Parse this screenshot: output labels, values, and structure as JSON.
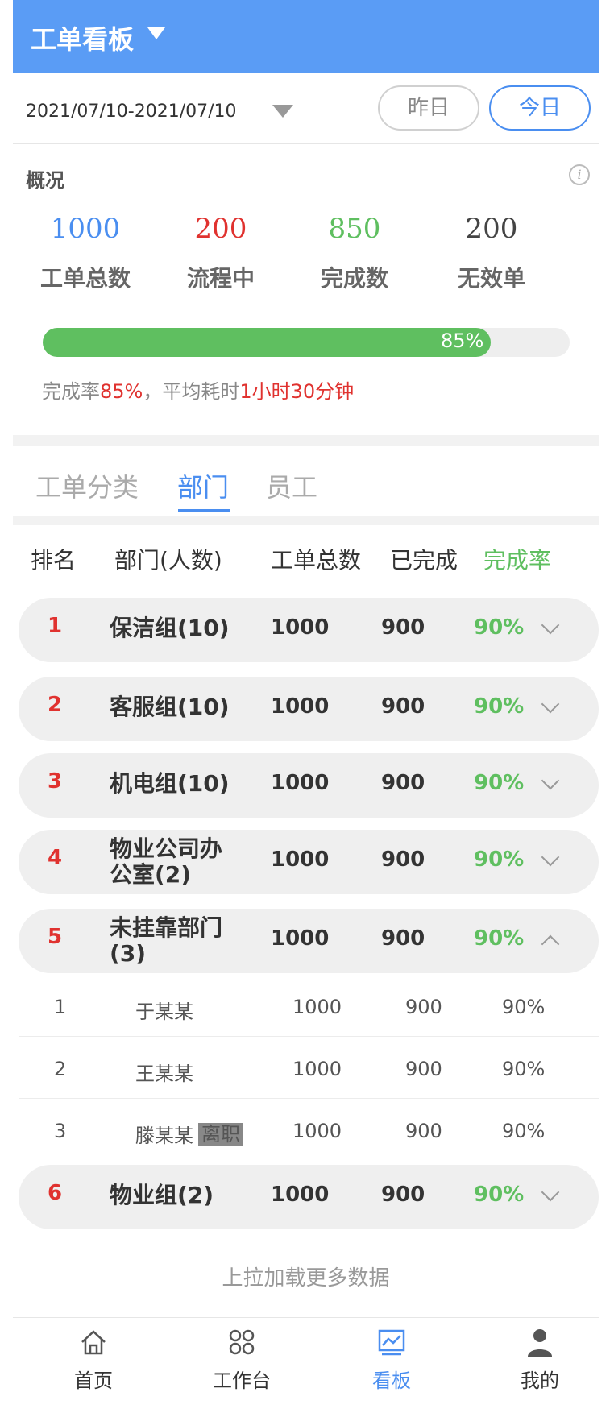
{
  "header": {
    "title": "工单看板"
  },
  "date_filter": {
    "range": "2021/07/10-2021/07/10",
    "yesterday": "昨日",
    "today": "今日"
  },
  "overview": {
    "title": "概况",
    "stats": [
      {
        "value": "1000",
        "label": "工单总数",
        "color": "#4a8ef0"
      },
      {
        "value": "200",
        "label": "流程中",
        "color": "#e0322f"
      },
      {
        "value": "850",
        "label": "完成数",
        "color": "#5fbf60"
      },
      {
        "value": "200",
        "label": "无效单",
        "color": "#444444"
      }
    ],
    "progress_percent": 85,
    "progress_text": "85%",
    "summary": {
      "prefix": "完成率",
      "rate": "85%",
      "mid": "，平均耗时",
      "duration": "1小时30分钟"
    }
  },
  "tabs": [
    "工单分类",
    "部门",
    "员工"
  ],
  "active_tab": "部门",
  "table": {
    "headers": [
      "排名",
      "部门(人数)",
      "工单总数",
      "已完成",
      "完成率"
    ],
    "rows": [
      {
        "rank": "1",
        "dept": "保洁组(10)",
        "total": "1000",
        "done": "900",
        "rate": "90%"
      },
      {
        "rank": "2",
        "dept": "客服组(10)",
        "total": "1000",
        "done": "900",
        "rate": "90%"
      },
      {
        "rank": "3",
        "dept": "机电组(10)",
        "total": "1000",
        "done": "900",
        "rate": "90%"
      },
      {
        "rank": "4",
        "dept": "物业公司办公室(2)",
        "total": "1000",
        "done": "900",
        "rate": "90%"
      },
      {
        "rank": "5",
        "dept": "未挂靠部门(3)",
        "total": "1000",
        "done": "900",
        "rate": "90%",
        "members": [
          {
            "rank": "1",
            "name": "于某某",
            "total": "1000",
            "done": "900",
            "rate": "90%"
          },
          {
            "rank": "2",
            "name": "王某某",
            "total": "1000",
            "done": "900",
            "rate": "90%"
          },
          {
            "rank": "3",
            "name": "滕某某",
            "badge": "离职",
            "total": "1000",
            "done": "900",
            "rate": "90%"
          }
        ]
      },
      {
        "rank": "6",
        "dept": "物业组(2)",
        "total": "1000",
        "done": "900",
        "rate": "90%"
      }
    ]
  },
  "load_more": "上拉加载更多数据",
  "bottom_nav": [
    {
      "label": "首页",
      "icon": "home-icon"
    },
    {
      "label": "工作台",
      "icon": "grid-icon"
    },
    {
      "label": "看板",
      "icon": "chart-icon"
    },
    {
      "label": "我的",
      "icon": "user-icon"
    }
  ],
  "bottom_nav_active": "看板",
  "colors": {
    "primary": "#5a9cf5",
    "accent_blue": "#4a8ef0",
    "red": "#e0322f",
    "green": "#5fbf60"
  }
}
